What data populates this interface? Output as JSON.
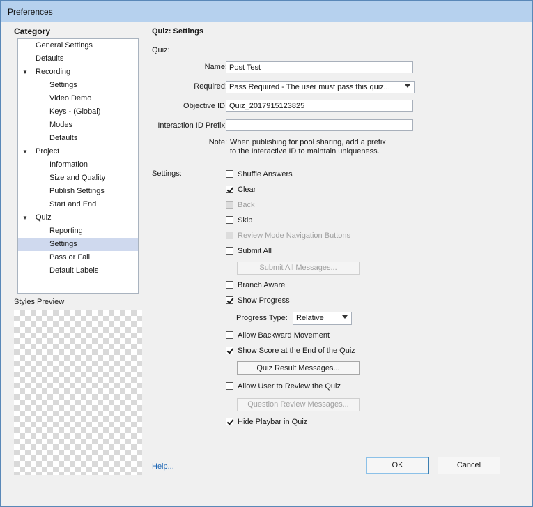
{
  "window": {
    "title": "Preferences"
  },
  "category": {
    "heading": "Category",
    "items": [
      {
        "label": "General Settings",
        "level": 0,
        "expander": false,
        "selected": false
      },
      {
        "label": "Defaults",
        "level": 0,
        "expander": false,
        "selected": false
      },
      {
        "label": "Recording",
        "level": 0,
        "expander": true,
        "selected": false
      },
      {
        "label": "Settings",
        "level": 1,
        "expander": false,
        "selected": false
      },
      {
        "label": "Video Demo",
        "level": 1,
        "expander": false,
        "selected": false
      },
      {
        "label": "Keys - (Global)",
        "level": 1,
        "expander": false,
        "selected": false
      },
      {
        "label": "Modes",
        "level": 1,
        "expander": false,
        "selected": false
      },
      {
        "label": "Defaults",
        "level": 1,
        "expander": false,
        "selected": false
      },
      {
        "label": "Project",
        "level": 0,
        "expander": true,
        "selected": false
      },
      {
        "label": "Information",
        "level": 1,
        "expander": false,
        "selected": false
      },
      {
        "label": "Size and Quality",
        "level": 1,
        "expander": false,
        "selected": false
      },
      {
        "label": "Publish Settings",
        "level": 1,
        "expander": false,
        "selected": false
      },
      {
        "label": "Start and End",
        "level": 1,
        "expander": false,
        "selected": false
      },
      {
        "label": "Quiz",
        "level": 0,
        "expander": true,
        "selected": false
      },
      {
        "label": "Reporting",
        "level": 1,
        "expander": false,
        "selected": false
      },
      {
        "label": "Settings",
        "level": 1,
        "expander": false,
        "selected": true
      },
      {
        "label": "Pass or Fail",
        "level": 1,
        "expander": false,
        "selected": false
      },
      {
        "label": "Default Labels",
        "level": 1,
        "expander": false,
        "selected": false
      }
    ]
  },
  "styles_preview": {
    "label": "Styles Preview"
  },
  "panel": {
    "title": "Quiz: Settings",
    "quiz_section": "Quiz:",
    "name_label": "Name:",
    "name_value": "Post Test",
    "required_label": "Required:",
    "required_value": "Pass Required - The user must pass this quiz...",
    "objective_label": "Objective ID:",
    "objective_value": "Quiz_2017915123825",
    "prefix_label": "Interaction ID Prefix:",
    "prefix_value": "",
    "note_label": "Note:",
    "note_line1": "When publishing for pool sharing, add a prefix",
    "note_line2": "to the Interactive ID to maintain uniqueness.",
    "settings_section": "Settings:",
    "checkboxes": [
      {
        "label": "Shuffle Answers",
        "checked": false,
        "enabled": true
      },
      {
        "label": "Clear",
        "checked": true,
        "enabled": true
      },
      {
        "label": "Back",
        "checked": false,
        "enabled": false
      },
      {
        "label": "Skip",
        "checked": false,
        "enabled": true
      },
      {
        "label": "Review Mode Navigation Buttons",
        "checked": false,
        "enabled": false
      },
      {
        "label": "Submit All",
        "checked": false,
        "enabled": true
      },
      {
        "label": "Branch Aware",
        "checked": false,
        "enabled": true
      },
      {
        "label": "Show Progress",
        "checked": true,
        "enabled": true
      },
      {
        "label": "Allow Backward Movement",
        "checked": false,
        "enabled": true
      },
      {
        "label": "Show Score at the End of the Quiz",
        "checked": true,
        "enabled": true
      },
      {
        "label": "Allow User to Review the Quiz",
        "checked": false,
        "enabled": true
      },
      {
        "label": "Hide Playbar in Quiz",
        "checked": true,
        "enabled": true
      }
    ],
    "submit_all_messages": "Submit All Messages...",
    "progress_type_label": "Progress Type:",
    "progress_type_value": "Relative",
    "quiz_result_messages": "Quiz Result Messages...",
    "question_review_messages": "Question Review Messages...",
    "help": "Help..."
  },
  "buttons": {
    "ok": "OK",
    "cancel": "Cancel"
  }
}
